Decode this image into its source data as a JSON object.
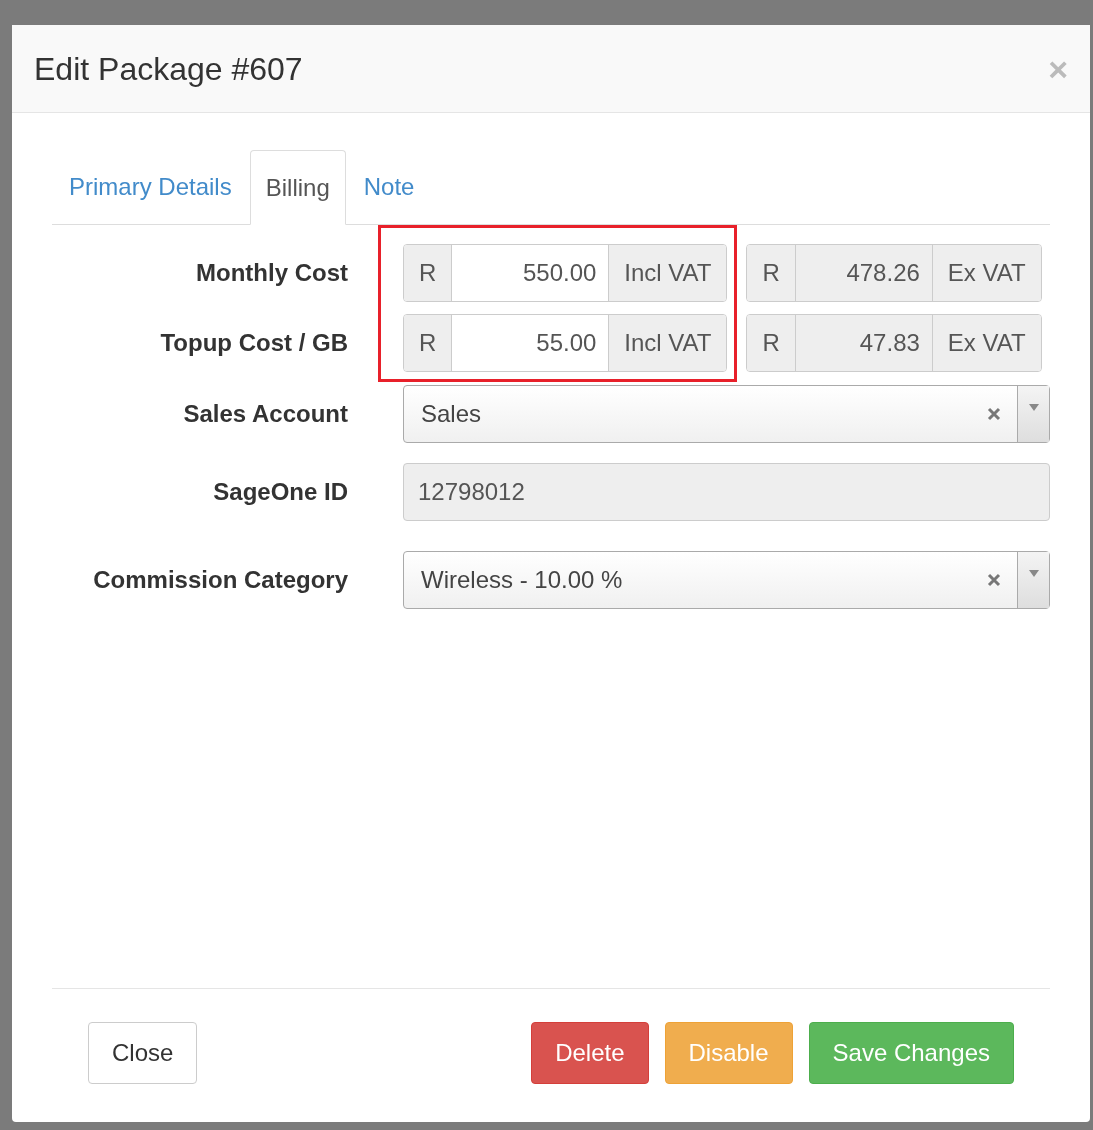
{
  "modal": {
    "title": "Edit Package #607",
    "close": "×"
  },
  "tabs": [
    {
      "label": "Primary Details",
      "selected": false
    },
    {
      "label": "Billing",
      "selected": true
    },
    {
      "label": "Note",
      "selected": false
    }
  ],
  "highlight": true,
  "cost_rows": [
    {
      "label": "Monthly Cost",
      "currency": "R",
      "incl_value": "550.00",
      "incl_suffix": "Incl VAT",
      "ex_currency": "R",
      "ex_value": "478.26",
      "ex_suffix": "Ex VAT"
    },
    {
      "label": "Topup Cost / GB",
      "currency": "R",
      "incl_value": "55.00",
      "incl_suffix": "Incl VAT",
      "ex_currency": "R",
      "ex_value": "47.83",
      "ex_suffix": "Ex VAT"
    }
  ],
  "fields": [
    {
      "kind": "select",
      "label": "Sales Account",
      "value": "Sales"
    },
    {
      "kind": "readonly",
      "label": "SageOne ID",
      "value": "12798012"
    },
    {
      "kind": "select",
      "label": "Commission Category",
      "value": "Wireless - 10.00 %"
    }
  ],
  "buttons": [
    {
      "label": "Close",
      "kind": "default"
    },
    {
      "label": "Delete",
      "kind": "danger"
    },
    {
      "label": "Disable",
      "kind": "warning"
    },
    {
      "label": "Save Changes",
      "kind": "success"
    }
  ]
}
